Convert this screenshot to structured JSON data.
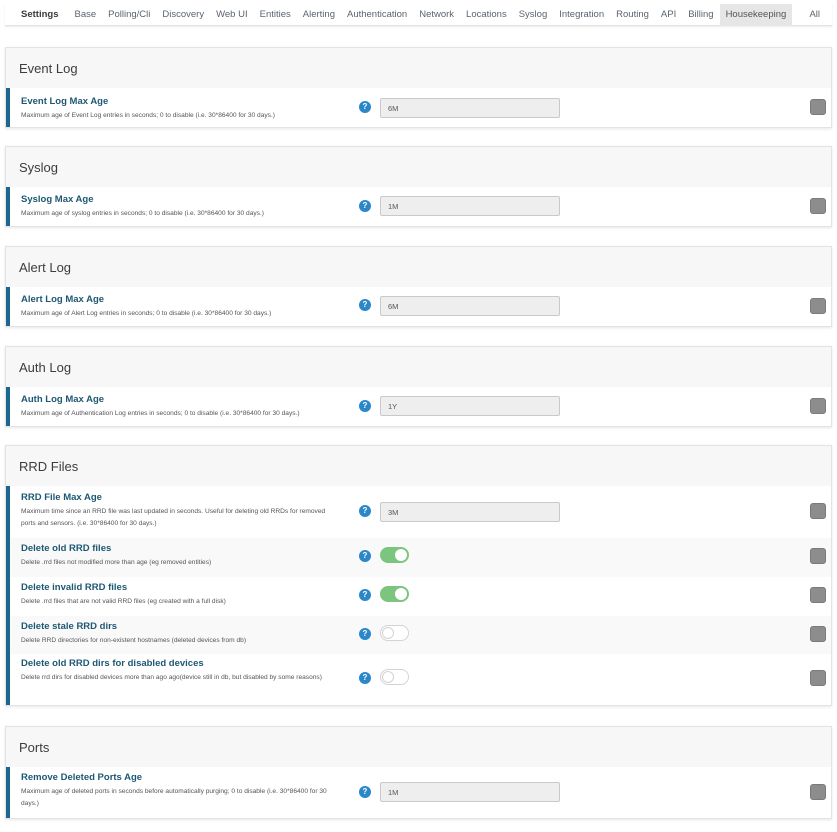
{
  "nav": {
    "brand": "Settings",
    "items": [
      "Base",
      "Polling/Cli",
      "Discovery",
      "Web UI",
      "Entities",
      "Alerting",
      "Authentication",
      "Network",
      "Locations",
      "Syslog",
      "Integration",
      "Routing",
      "API",
      "Billing",
      "Housekeeping"
    ],
    "active": "Housekeeping",
    "all": "All"
  },
  "sections": [
    {
      "title": "Event Log",
      "rows": [
        {
          "title": "Event Log Max Age",
          "desc": "Maximum age of Event Log entries in seconds; 0 to disable (i.e. 30*86400 for 30 days.)",
          "control": "input",
          "value": "6M"
        }
      ]
    },
    {
      "title": "Syslog",
      "rows": [
        {
          "title": "Syslog Max Age",
          "desc": "Maximum age of syslog entries in seconds; 0 to disable (i.e. 30*86400 for 30 days.)",
          "control": "input",
          "value": "1M"
        }
      ]
    },
    {
      "title": "Alert Log",
      "rows": [
        {
          "title": "Alert Log Max Age",
          "desc": "Maximum age of Alert Log entries in seconds; 0 to disable (i.e. 30*86400 for 30 days.)",
          "control": "input",
          "value": "6M"
        }
      ]
    },
    {
      "title": "Auth Log",
      "rows": [
        {
          "title": "Auth Log Max Age",
          "desc": "Maximum age of Authentication Log entries in seconds; 0 to disable (i.e. 30*86400 for 30 days.)",
          "control": "input",
          "value": "1Y"
        }
      ]
    },
    {
      "title": "RRD Files",
      "rows": [
        {
          "title": "RRD File Max Age",
          "desc": "Maximum time since an RRD file was last updated in seconds. Useful for deleting old RRDs for removed ports and sensors. (i.e. 30*86400 for 30 days.)",
          "control": "input",
          "value": "3M"
        },
        {
          "title": "Delete old RRD files",
          "desc": "Delete .rrd files not modified more than age (eg removed entities)",
          "control": "toggle",
          "on": true
        },
        {
          "title": "Delete invalid RRD files",
          "desc": "Delete .rrd files that are not valid RRD files (eg created with a full disk)",
          "control": "toggle",
          "on": true
        },
        {
          "title": "Delete stale RRD dirs",
          "desc": "Delete RRD directories for non-existent hostnames (deleted devices from db)",
          "control": "toggle",
          "on": false
        },
        {
          "title": "Delete old RRD dirs for disabled devices",
          "desc": "Delete rrd dirs for disabled devices more than ago ago(device still in db, but disabled by some reasons)",
          "control": "toggle",
          "on": false
        }
      ]
    },
    {
      "title": "Ports",
      "rows": [
        {
          "title": "Remove Deleted Ports Age",
          "desc": "Maximum age of deleted ports in seconds before automatically purging; 0 to disable (i.e. 30*86400 for 30 days.)",
          "control": "input",
          "value": "1M"
        }
      ]
    }
  ],
  "help_glyph": "?",
  "icons": {
    "help": "question-circle-icon",
    "lock": "lock-toggle-icon"
  },
  "colors": {
    "accent": "#1c6790",
    "toggle_on": "#7cc57f",
    "help": "#2c87c9"
  }
}
